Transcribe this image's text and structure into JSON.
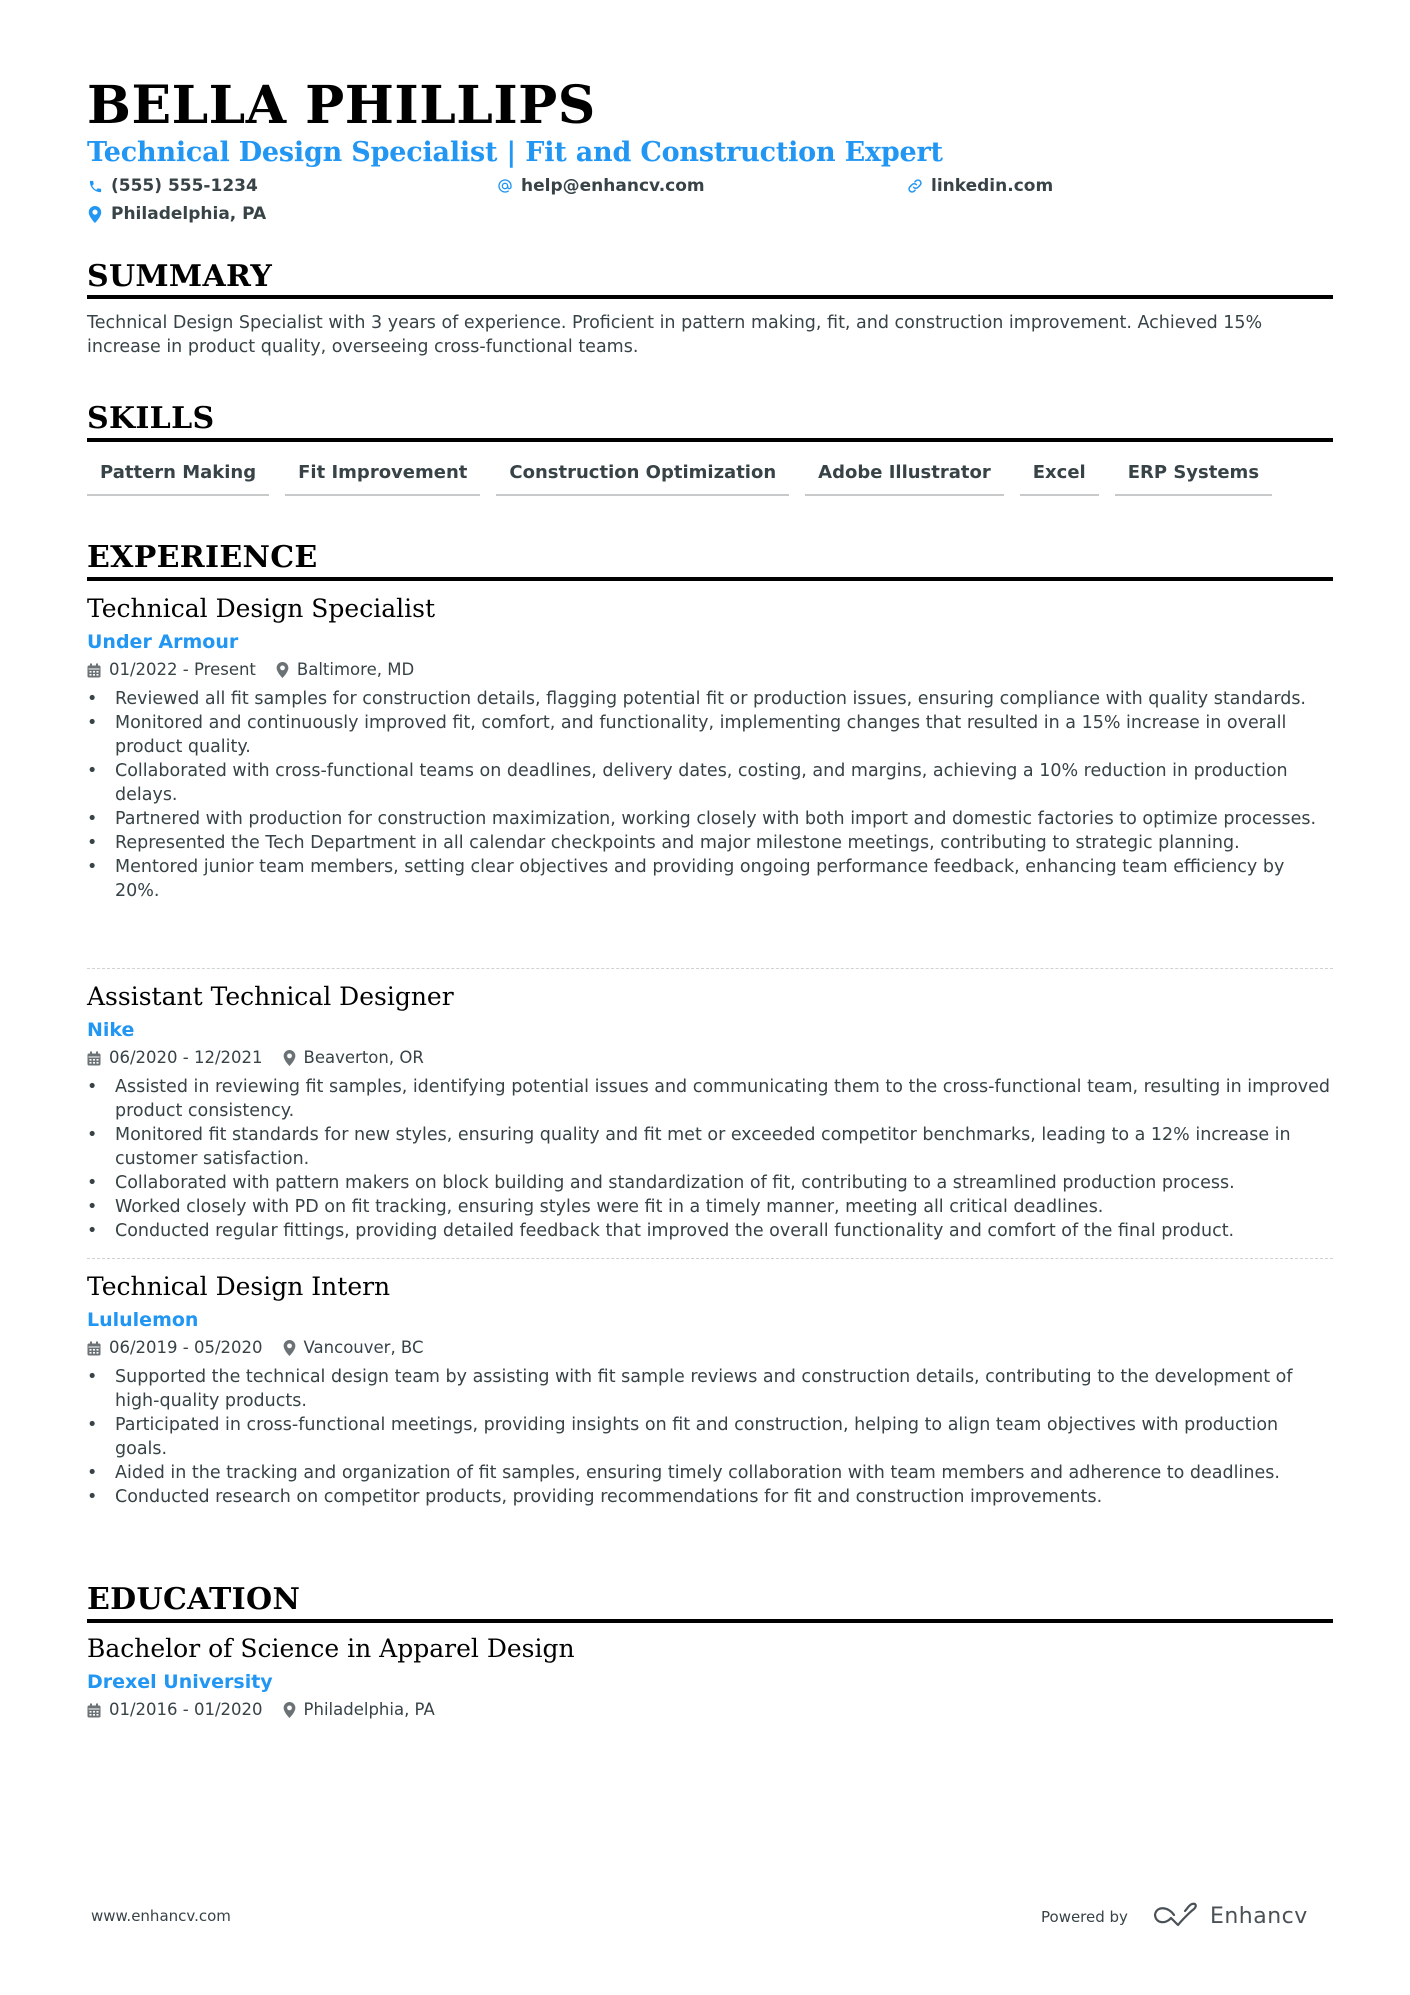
{
  "header": {
    "name": "BELLA PHILLIPS",
    "headline": "Technical Design Specialist | Fit and Construction Expert",
    "contacts": [
      {
        "icon": "phone-icon",
        "text": "(555) 555-1234"
      },
      {
        "icon": "at-icon",
        "text": "help@enhancv.com"
      },
      {
        "icon": "link-icon",
        "text": "linkedin.com"
      },
      {
        "icon": "location-pin-icon",
        "text": "Philadelphia, PA"
      }
    ]
  },
  "summary": {
    "title": "SUMMARY",
    "text": "Technical Design Specialist with 3 years of experience. Proficient in pattern making, fit, and construction improvement. Achieved 15% increase in product quality, overseeing cross-functional teams."
  },
  "skills": {
    "title": "SKILLS",
    "items": [
      "Pattern Making",
      "Fit Improvement",
      "Construction Optimization",
      "Adobe Illustrator",
      "Excel",
      "ERP Systems"
    ]
  },
  "experience": {
    "title": "EXPERIENCE",
    "jobs": [
      {
        "role": "Technical Design Specialist",
        "company": "Under Armour",
        "dates": "01/2022 - Present",
        "location": "Baltimore, MD",
        "bullets": [
          "Reviewed all fit samples for construction details, flagging potential fit or production issues, ensuring compliance with quality standards.",
          "Monitored and continuously improved fit, comfort, and functionality, implementing changes that resulted in a 15% increase in overall product quality.",
          "Collaborated with cross-functional teams on deadlines, delivery dates, costing, and margins, achieving a 10% reduction in production delays.",
          "Partnered with production for construction maximization, working closely with both import and domestic factories to optimize processes.",
          "Represented the Tech Department in all calendar checkpoints and major milestone meetings, contributing to strategic planning.",
          "Mentored junior team members, setting clear objectives and providing ongoing performance feedback, enhancing team efficiency by 20%."
        ]
      },
      {
        "role": "Assistant Technical Designer",
        "company": "Nike",
        "dates": "06/2020 - 12/2021",
        "location": "Beaverton, OR",
        "bullets": [
          "Assisted in reviewing fit samples, identifying potential issues and communicating them to the cross-functional team, resulting in improved product consistency.",
          "Monitored fit standards for new styles, ensuring quality and fit met or exceeded competitor benchmarks, leading to a 12% increase in customer satisfaction.",
          "Collaborated with pattern makers on block building and standardization of fit, contributing to a streamlined production process.",
          "Worked closely with PD on fit tracking, ensuring styles were fit in a timely manner, meeting all critical deadlines.",
          "Conducted regular fittings, providing detailed feedback that improved the overall functionality and comfort of the final product."
        ]
      },
      {
        "role": "Technical Design Intern",
        "company": "Lululemon",
        "dates": "06/2019 - 05/2020",
        "location": "Vancouver, BC",
        "bullets": [
          "Supported the technical design team by assisting with fit sample reviews and construction details, contributing to the development of high-quality products.",
          "Participated in cross-functional meetings, providing insights on fit and construction, helping to align team objectives with production goals.",
          "Aided in the tracking and organization of fit samples, ensuring timely collaboration with team members and adherence to deadlines.",
          "Conducted research on competitor products, providing recommendations for fit and construction improvements."
        ]
      }
    ]
  },
  "education": {
    "title": "EDUCATION",
    "items": [
      {
        "degree": "Bachelor of Science in Apparel Design",
        "school": "Drexel University",
        "dates": "01/2016 - 01/2020",
        "location": "Philadelphia, PA"
      }
    ]
  },
  "footer": {
    "website": "www.enhancv.com",
    "powered_by": "Powered by",
    "brand": "Enhancv"
  },
  "colors": {
    "accent": "#2196f3",
    "text": "#384347",
    "heading": "#000000"
  }
}
